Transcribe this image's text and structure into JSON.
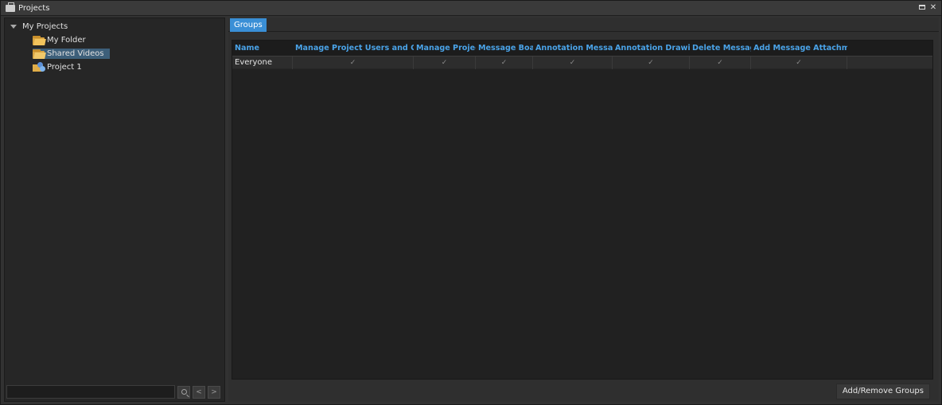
{
  "window": {
    "title": "Projects"
  },
  "tree": {
    "root_label": "My Projects",
    "items": [
      {
        "label": "My Folder",
        "icon": "folder-icon"
      },
      {
        "label": "Shared Videos",
        "icon": "shared-folder-icon",
        "selected": true
      },
      {
        "label": "Project 1",
        "icon": "project-icon"
      }
    ]
  },
  "search": {
    "value": "",
    "prev_label": "<",
    "next_label": ">"
  },
  "tabs": [
    {
      "label": "Groups",
      "active": true
    }
  ],
  "table": {
    "columns": [
      "Name",
      "Manage Project Users and Groups",
      "Manage Projects",
      "Message Board",
      "Annotation Messages",
      "Annotation Drawings",
      "Delete Messages",
      "Add Message Attachments"
    ],
    "rows": [
      {
        "name": "Everyone",
        "checks": [
          "✓",
          "✓",
          "✓",
          "✓",
          "✓",
          "✓",
          "✓"
        ]
      }
    ]
  },
  "footer": {
    "add_remove_label": "Add/Remove Groups"
  },
  "colors": {
    "accent": "#3a8fd6",
    "header_text": "#4aa3e8",
    "selection": "#3d5f7a"
  }
}
